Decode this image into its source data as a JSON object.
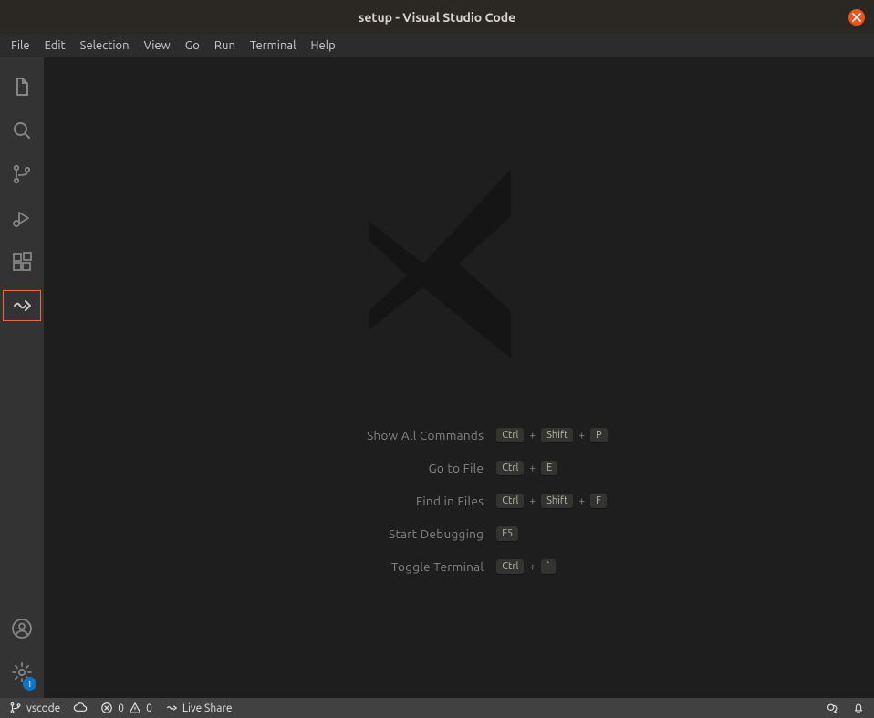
{
  "title": "setup - Visual Studio Code",
  "menubar": [
    "File",
    "Edit",
    "Selection",
    "View",
    "Go",
    "Run",
    "Terminal",
    "Help"
  ],
  "activity": {
    "settings_badge": "1"
  },
  "shortcuts": [
    {
      "label": "Show All Commands",
      "keys": [
        "Ctrl",
        "Shift",
        "P"
      ]
    },
    {
      "label": "Go to File",
      "keys": [
        "Ctrl",
        "E"
      ]
    },
    {
      "label": "Find in Files",
      "keys": [
        "Ctrl",
        "Shift",
        "F"
      ]
    },
    {
      "label": "Start Debugging",
      "keys": [
        "F5"
      ]
    },
    {
      "label": "Toggle Terminal",
      "keys": [
        "Ctrl",
        "`"
      ]
    }
  ],
  "status": {
    "branch": "vscode",
    "errors": "0",
    "warnings": "0",
    "live_share": "Live Share"
  }
}
